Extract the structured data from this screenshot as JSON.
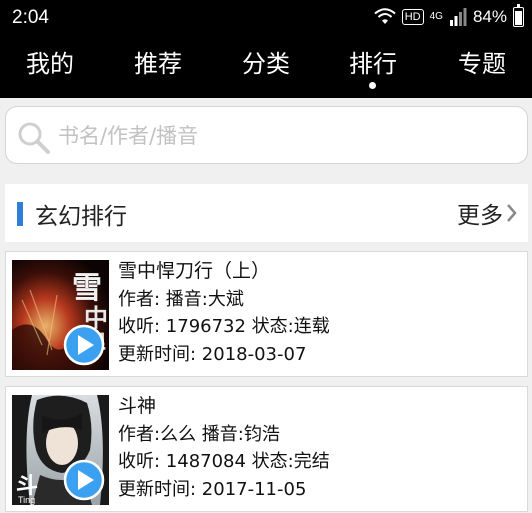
{
  "status_bar": {
    "time": "2:04",
    "hd": "HD",
    "network": "4G",
    "battery": "84%"
  },
  "nav": {
    "tabs": [
      {
        "label": "我的"
      },
      {
        "label": "推荐"
      },
      {
        "label": "分类"
      },
      {
        "label": "排行"
      },
      {
        "label": "专题"
      }
    ],
    "active_tab": "排行"
  },
  "search": {
    "placeholder": "书名/作者/播音"
  },
  "section": {
    "title": "玄幻排行",
    "more": "更多"
  },
  "books": [
    {
      "title": "雪中悍刀行（上）",
      "author_line": "作者: 播音:大斌",
      "listens_line": "收听: 1796732 状态:连载",
      "updated_line": "更新时间: 2018-03-07",
      "cover_text": "雪中悍刀"
    },
    {
      "title": "斗神",
      "author_line": "作者:么么 播音:钧浩",
      "listens_line": "收听: 1487084 状态:完结",
      "updated_line": "更新时间: 2017-11-05",
      "cover_text": "斗 Ting"
    }
  ],
  "colors": {
    "accent": "#2f7fd6",
    "bar": "#000000",
    "play": "#3aa0ef"
  }
}
